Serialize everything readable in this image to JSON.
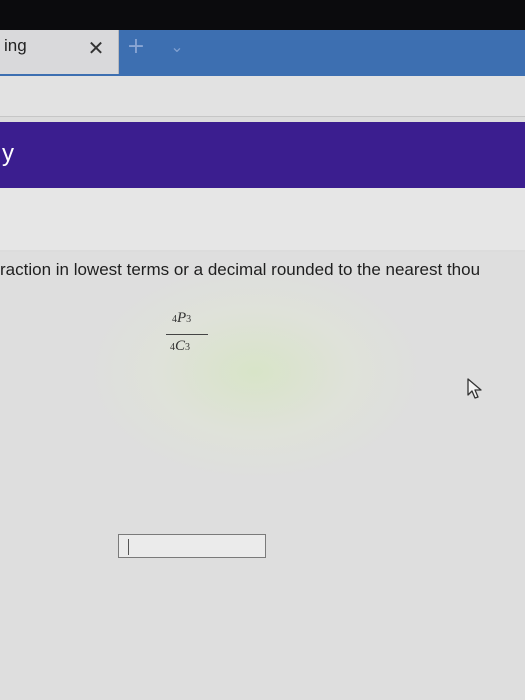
{
  "browser": {
    "tab": {
      "title": "ing",
      "close_label": "✕"
    },
    "new_tab_label": "+",
    "tab_dropdown_label": "⌄"
  },
  "banner": {
    "text": "y"
  },
  "question": {
    "instruction": "raction in lowest terms or a decimal rounded to the nearest thou",
    "expression": {
      "numerator": {
        "prefix": "4",
        "letter": "P",
        "subscript": "3"
      },
      "denominator": {
        "prefix": "4",
        "letter": "C",
        "subscript": "3"
      }
    }
  },
  "answer": {
    "value": ""
  },
  "icons": {
    "cursor": "mouse-pointer-icon",
    "close": "close-icon",
    "add": "plus-icon",
    "dropdown": "chevron-down-icon"
  },
  "colors": {
    "banner": "#3b1e8f",
    "tabstrip": "#3d6fb1"
  }
}
